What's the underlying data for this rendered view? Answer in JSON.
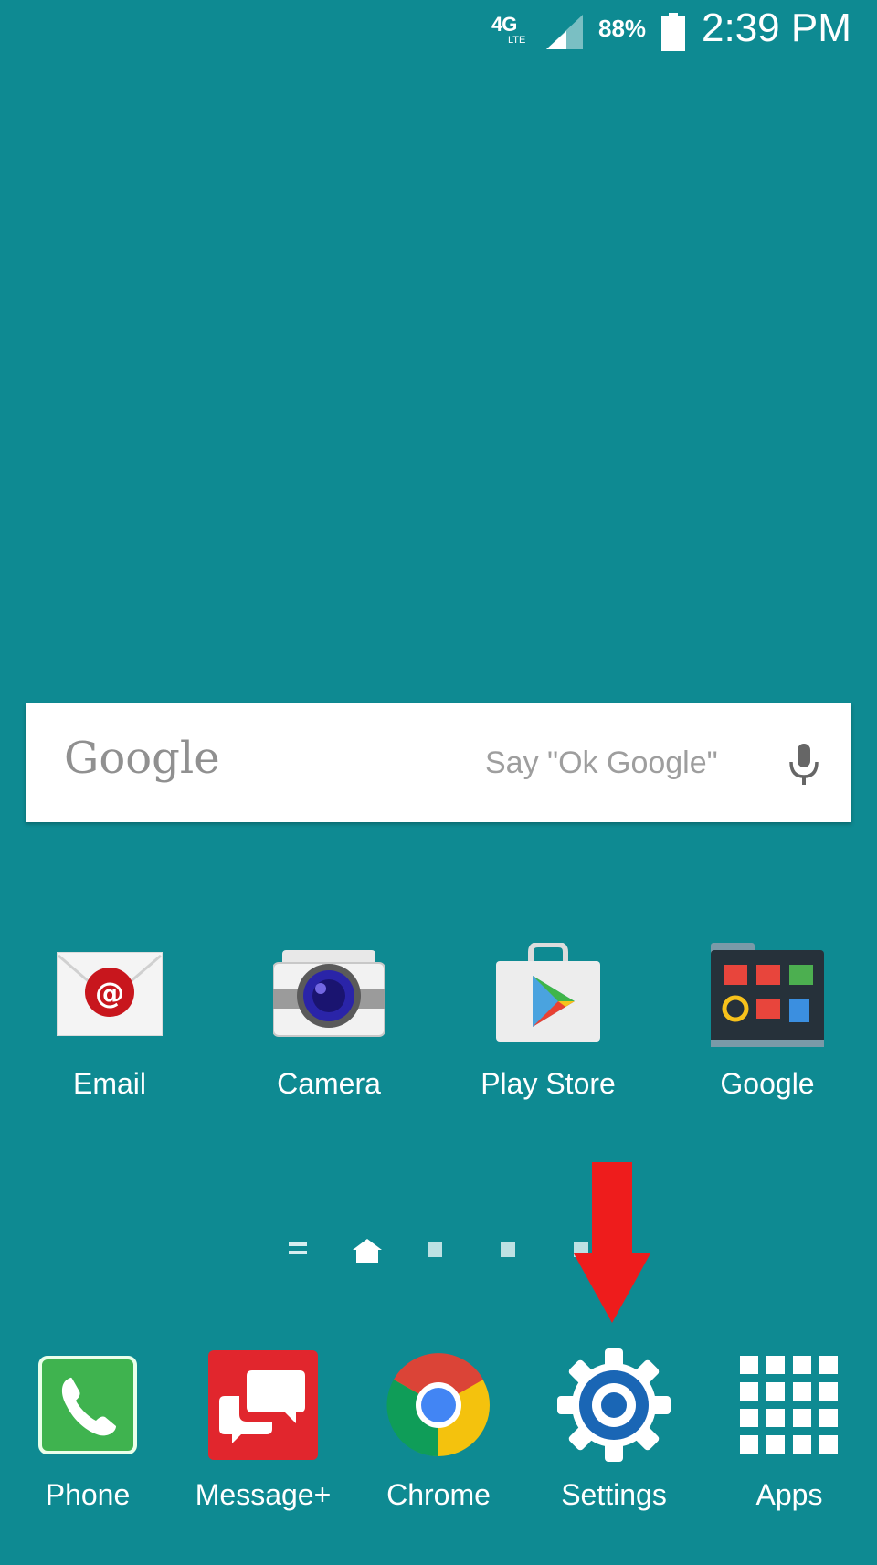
{
  "status_bar": {
    "network": "4G",
    "network_sub": "LTE",
    "battery": "88%",
    "battery_level": 0.88,
    "time": "2:39 PM"
  },
  "search": {
    "logo": "Google",
    "hint": "Say \"Ok Google\""
  },
  "apps": [
    {
      "label": "Email",
      "icon": "email-icon"
    },
    {
      "label": "Camera",
      "icon": "camera-icon"
    },
    {
      "label": "Play Store",
      "icon": "play-store-icon"
    },
    {
      "label": "Google",
      "icon": "google-folder-icon"
    }
  ],
  "dock": [
    {
      "label": "Phone",
      "icon": "phone-icon"
    },
    {
      "label": "Message+",
      "icon": "messages-icon"
    },
    {
      "label": "Chrome",
      "icon": "chrome-icon"
    },
    {
      "label": "Settings",
      "icon": "gear-icon"
    },
    {
      "label": "Apps",
      "icon": "apps-grid-icon"
    }
  ],
  "colors": {
    "wallpaper": "#0e8a92",
    "arrow": "#ee1c1c",
    "settings_blue": "#1a66b5"
  }
}
